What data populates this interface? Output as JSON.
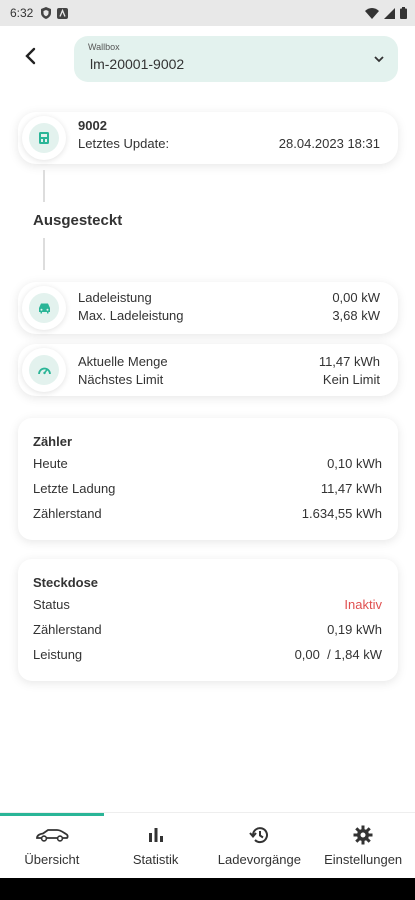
{
  "status_bar": {
    "time": "6:32"
  },
  "header": {
    "wallbox_label": "Wallbox",
    "wallbox_value": "lm-20001-9002"
  },
  "device_card": {
    "id": "9002",
    "update_label": "Letztes Update:",
    "update_value": "28.04.2023 18:31"
  },
  "connection_state": "Ausgesteckt",
  "power_card": {
    "rows": [
      {
        "label": "Ladeleistung",
        "value": "0,00 kW"
      },
      {
        "label": "Max. Ladeleistung",
        "value": "3,68 kW"
      }
    ]
  },
  "amount_card": {
    "rows": [
      {
        "label": "Aktuelle Menge",
        "value": "11,47 kWh"
      },
      {
        "label": "Nächstes Limit",
        "value": "Kein Limit"
      }
    ]
  },
  "meter": {
    "title": "Zähler",
    "rows": [
      {
        "label": "Heute",
        "value": "0,10 kWh"
      },
      {
        "label": "Letzte Ladung",
        "value": "11,47 kWh"
      },
      {
        "label": "Zählerstand",
        "value": "1.634,55 kWh"
      }
    ]
  },
  "socket": {
    "title": "Steckdose",
    "rows": [
      {
        "label": "Status",
        "value": "Inaktiv"
      },
      {
        "label": "Zählerstand",
        "value": "0,19 kWh"
      },
      {
        "label": "Leistung",
        "value": "0,00  / 1,84 kW"
      }
    ]
  },
  "nav": [
    {
      "label": "Übersicht",
      "icon": "car-icon"
    },
    {
      "label": "Statistik",
      "icon": "bar-chart-icon"
    },
    {
      "label": "Ladevorgänge",
      "icon": "history-icon"
    },
    {
      "label": "Einstellungen",
      "icon": "gear-icon"
    }
  ],
  "colors": {
    "accent": "#2ab597",
    "accent_light": "#e3f2ee",
    "inactive": "#e05050"
  }
}
